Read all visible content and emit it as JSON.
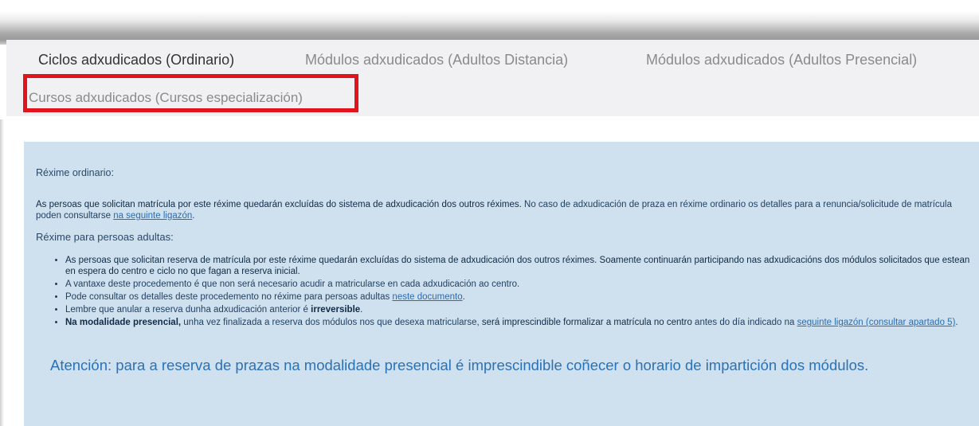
{
  "tabs": [
    {
      "label": "Ciclos adxudicados (Ordinario)",
      "active": true
    },
    {
      "label": "Módulos adxudicados (Adultos Distancia)",
      "active": false
    },
    {
      "label": "Módulos adxudicados (Adultos Presencial)",
      "active": false
    },
    {
      "label": "Cursos adxudicados (Cursos especialización)",
      "active": false
    }
  ],
  "info": {
    "ordinary_heading": "Réxime ordinario:",
    "ordinary_text_dark": "As persoas que solicitan matrícula por este réxime quedarán excluídas do sistema de adxudicación dos outros réximes.",
    "ordinary_text": " No caso de adxudicación de praza en réxime ordinario os detalles para a renuncia/solicitude de matrícula poden consultarse ",
    "ordinary_link": "na seguinte ligazón",
    "ordinary_end": ".",
    "adults_heading": "Réxime para persoas adultas:",
    "bullet1_dark": "As persoas que solicitan reserva de matrícula por este réxime quedarán excluídas do sistema de adxudicación dos outros réximes. Soamente continuarán participando nas adxudicacións dos módulos solicitados que estean en espera do centro e ciclo no que fagan a reserva inicial.",
    "bullet2": "A vantaxe deste procedemento é que non será necesario acudir a matricularse en cada adxudicación ao centro.",
    "bullet3_text": "Pode consultar os detalles deste procedemento no réxime para persoas adultas ",
    "bullet3_link": "neste documento",
    "bullet3_end": ".",
    "bullet4_text": "Lembre que anular a reserva dunha adxudicación anterior é ",
    "bullet4_bold": "irreversible",
    "bullet4_end": ".",
    "bullet5_bold": "Na modalidade presencial,",
    "bullet5_text": " unha vez finalizada a reserva dos módulos nos que desexa matricularse, ",
    "bullet5_dark": "será imprescindible formalizar a matrícula no centro",
    "bullet5_text2": " antes do día indicado na ",
    "bullet5_link": "seguinte ligazón (consultar apartado 5)",
    "bullet5_end": ".",
    "attention": "Atención: para a reserva de prazas na modalidade presencial é imprescindible coñecer o horario de impartición dos módulos."
  },
  "colors": {
    "highlight": "#e1141e",
    "panel": "#cfe0ee",
    "link": "#2a6db3",
    "attention": "#2a72b8"
  }
}
